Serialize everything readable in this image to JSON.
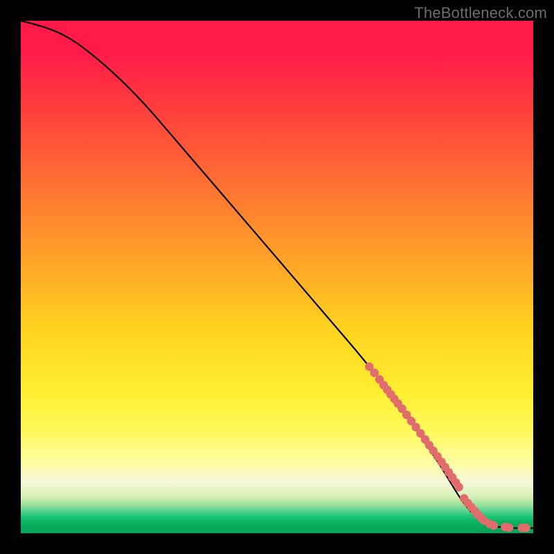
{
  "watermark": "TheBottleneck.com",
  "chart_data": {
    "type": "line",
    "title": "",
    "xlabel": "",
    "ylabel": "",
    "xlim": [
      0,
      100
    ],
    "ylim": [
      0,
      100
    ],
    "grid": false,
    "legend": false,
    "annotations": [],
    "series": [
      {
        "name": "curve",
        "style": "line",
        "color": "#000000",
        "x": [
          0,
          4,
          8,
          12,
          18,
          24,
          30,
          36,
          42,
          48,
          54,
          60,
          66,
          70,
          74,
          78,
          82,
          85,
          87,
          90,
          94,
          100
        ],
        "y": [
          100,
          99,
          97.5,
          95,
          90,
          84,
          77,
          70,
          63,
          56,
          49,
          42,
          35,
          30,
          25,
          19,
          13,
          8,
          5,
          2,
          1,
          1
        ]
      },
      {
        "name": "highlighted-points-lower",
        "style": "dots",
        "color": "#e06c6c",
        "x": [
          68,
          69,
          70,
          70.8,
          71.5,
          72.2,
          72.9,
          73.6,
          74.4,
          75.3,
          76.2,
          77.1,
          78,
          78.9,
          79.7,
          80.5,
          81.3,
          82.1,
          82.8,
          83.5,
          84.2,
          84.9,
          85.5
        ],
        "y": [
          32.5,
          31.3,
          30,
          28.9,
          28,
          27.1,
          26.2,
          25.3,
          24.3,
          23.1,
          21.9,
          20.7,
          19.5,
          18.3,
          17.2,
          16.1,
          15,
          13.9,
          12.9,
          11.9,
          10.9,
          9.9,
          9
        ]
      },
      {
        "name": "highlighted-points-tail",
        "style": "dots",
        "color": "#e06c6c",
        "x": [
          86.5,
          87.2,
          87.9,
          88.6,
          89.2,
          89.8,
          90.4,
          91.5,
          92.3,
          94.5,
          95.3,
          97.8,
          98.6
        ],
        "y": [
          6.8,
          5.9,
          5.1,
          4.3,
          3.6,
          3,
          2.5,
          1.8,
          1.5,
          1.2,
          1.1,
          1.05,
          1.05
        ]
      }
    ],
    "background_gradient_stops": [
      {
        "pos": 0.0,
        "color": "#ff1a4a"
      },
      {
        "pos": 0.3,
        "color": "#ff6a34"
      },
      {
        "pos": 0.6,
        "color": "#ffd21f"
      },
      {
        "pos": 0.86,
        "color": "#fdfda0"
      },
      {
        "pos": 0.96,
        "color": "#20c67a"
      },
      {
        "pos": 1.0,
        "color": "#07a255"
      }
    ]
  }
}
